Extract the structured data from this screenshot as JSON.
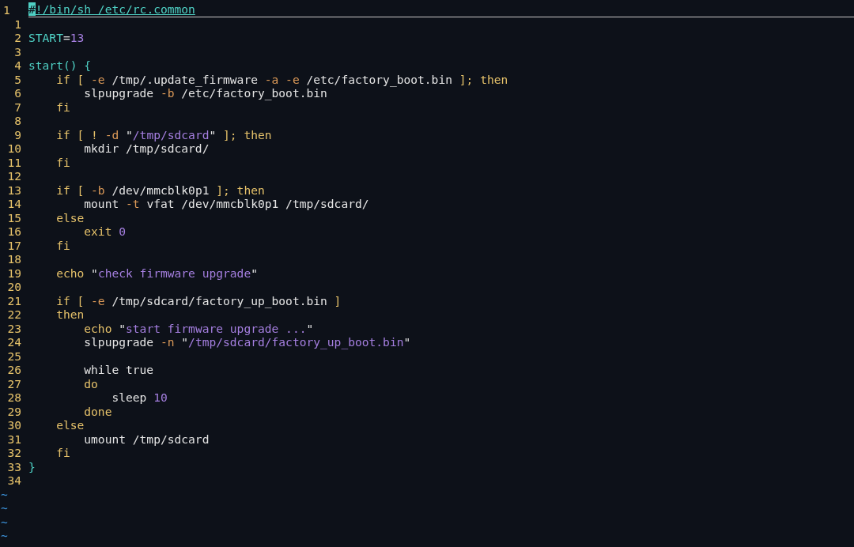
{
  "editor": {
    "lines": [
      {
        "number": "1",
        "current": true,
        "tokens": [
          {
            "kind": "cursor",
            "text": "#"
          },
          {
            "kind": "shebang",
            "text": "!/bin/sh /etc/rc.common"
          }
        ]
      },
      {
        "number": "1",
        "current": false
      },
      {
        "number": "2",
        "current": false,
        "tokens": [
          {
            "kind": "ident",
            "text": "START"
          },
          {
            "kind": "plain",
            "text": "="
          },
          {
            "kind": "number",
            "text": "13"
          }
        ]
      },
      {
        "number": "3",
        "current": false
      },
      {
        "number": "4",
        "current": false,
        "tokens": [
          {
            "kind": "ident",
            "text": "start() {"
          }
        ]
      },
      {
        "number": "5",
        "current": false,
        "tokens": [
          {
            "kind": "keyword",
            "text": "    if [ "
          },
          {
            "kind": "option",
            "text": "-e"
          },
          {
            "kind": "plain",
            "text": " /tmp/.update_firmware "
          },
          {
            "kind": "option",
            "text": "-a -e"
          },
          {
            "kind": "plain",
            "text": " /etc/factory_boot.bin "
          },
          {
            "kind": "keyword",
            "text": "]; then"
          }
        ]
      },
      {
        "number": "6",
        "current": false,
        "tokens": [
          {
            "kind": "plain",
            "text": "        slpupgrade "
          },
          {
            "kind": "option",
            "text": "-b"
          },
          {
            "kind": "plain",
            "text": " /etc/factory_boot.bin"
          }
        ]
      },
      {
        "number": "7",
        "current": false,
        "tokens": [
          {
            "kind": "keyword",
            "text": "    fi"
          }
        ]
      },
      {
        "number": "8",
        "current": false
      },
      {
        "number": "9",
        "current": false,
        "tokens": [
          {
            "kind": "keyword",
            "text": "    if [ ! "
          },
          {
            "kind": "option",
            "text": "-d"
          },
          {
            "kind": "plain",
            "text": " \""
          },
          {
            "kind": "string",
            "text": "/tmp/sdcard"
          },
          {
            "kind": "plain",
            "text": "\" "
          },
          {
            "kind": "keyword",
            "text": "]; then"
          }
        ]
      },
      {
        "number": "10",
        "current": false,
        "tokens": [
          {
            "kind": "plain",
            "text": "        mkdir /tmp/sdcard/"
          }
        ]
      },
      {
        "number": "11",
        "current": false,
        "tokens": [
          {
            "kind": "keyword",
            "text": "    fi"
          }
        ]
      },
      {
        "number": "12",
        "current": false
      },
      {
        "number": "13",
        "current": false,
        "tokens": [
          {
            "kind": "keyword",
            "text": "    if [ "
          },
          {
            "kind": "option",
            "text": "-b"
          },
          {
            "kind": "plain",
            "text": " /dev/mmcblk0p1 "
          },
          {
            "kind": "keyword",
            "text": "]; then"
          }
        ]
      },
      {
        "number": "14",
        "current": false,
        "tokens": [
          {
            "kind": "plain",
            "text": "        mount "
          },
          {
            "kind": "option",
            "text": "-t"
          },
          {
            "kind": "plain",
            "text": " vfat /dev/mmcblk0p1 /tmp/sdcard/"
          }
        ]
      },
      {
        "number": "15",
        "current": false,
        "tokens": [
          {
            "kind": "keyword",
            "text": "    else"
          }
        ]
      },
      {
        "number": "16",
        "current": false,
        "tokens": [
          {
            "kind": "keyword",
            "text": "        exit "
          },
          {
            "kind": "number",
            "text": "0"
          }
        ]
      },
      {
        "number": "17",
        "current": false,
        "tokens": [
          {
            "kind": "keyword",
            "text": "    fi"
          }
        ]
      },
      {
        "number": "18",
        "current": false
      },
      {
        "number": "19",
        "current": false,
        "tokens": [
          {
            "kind": "keyword",
            "text": "    echo "
          },
          {
            "kind": "plain",
            "text": "\""
          },
          {
            "kind": "string",
            "text": "check firmware upgrade"
          },
          {
            "kind": "plain",
            "text": "\""
          }
        ]
      },
      {
        "number": "20",
        "current": false
      },
      {
        "number": "21",
        "current": false,
        "tokens": [
          {
            "kind": "keyword",
            "text": "    if [ "
          },
          {
            "kind": "option",
            "text": "-e"
          },
          {
            "kind": "plain",
            "text": " /tmp/sdcard/factory_up_boot.bin "
          },
          {
            "kind": "keyword",
            "text": "]"
          }
        ]
      },
      {
        "number": "22",
        "current": false,
        "tokens": [
          {
            "kind": "keyword",
            "text": "    then"
          }
        ]
      },
      {
        "number": "23",
        "current": false,
        "tokens": [
          {
            "kind": "keyword",
            "text": "        echo "
          },
          {
            "kind": "plain",
            "text": "\""
          },
          {
            "kind": "string",
            "text": "start firmware upgrade ..."
          },
          {
            "kind": "plain",
            "text": "\""
          }
        ]
      },
      {
        "number": "24",
        "current": false,
        "tokens": [
          {
            "kind": "plain",
            "text": "        slpupgrade "
          },
          {
            "kind": "option",
            "text": "-n"
          },
          {
            "kind": "plain",
            "text": " \""
          },
          {
            "kind": "string",
            "text": "/tmp/sdcard/factory_up_boot.bin"
          },
          {
            "kind": "plain",
            "text": "\""
          }
        ]
      },
      {
        "number": "25",
        "current": false
      },
      {
        "number": "26",
        "current": false,
        "tokens": [
          {
            "kind": "plain",
            "text": "        while true"
          }
        ]
      },
      {
        "number": "27",
        "current": false,
        "tokens": [
          {
            "kind": "keyword",
            "text": "        do"
          }
        ]
      },
      {
        "number": "28",
        "current": false,
        "tokens": [
          {
            "kind": "plain",
            "text": "            sleep "
          },
          {
            "kind": "number",
            "text": "10"
          }
        ]
      },
      {
        "number": "29",
        "current": false,
        "tokens": [
          {
            "kind": "keyword",
            "text": "        done"
          }
        ]
      },
      {
        "number": "30",
        "current": false,
        "tokens": [
          {
            "kind": "keyword",
            "text": "    else"
          }
        ]
      },
      {
        "number": "31",
        "current": false,
        "tokens": [
          {
            "kind": "plain",
            "text": "        umount /tmp/sdcard"
          }
        ]
      },
      {
        "number": "32",
        "current": false,
        "tokens": [
          {
            "kind": "keyword",
            "text": "    fi"
          }
        ]
      },
      {
        "number": "33",
        "current": false,
        "tokens": [
          {
            "kind": "ident",
            "text": "}"
          }
        ]
      },
      {
        "number": "34",
        "current": false
      }
    ],
    "end_markers": [
      "~",
      "~",
      "~",
      "~"
    ]
  }
}
